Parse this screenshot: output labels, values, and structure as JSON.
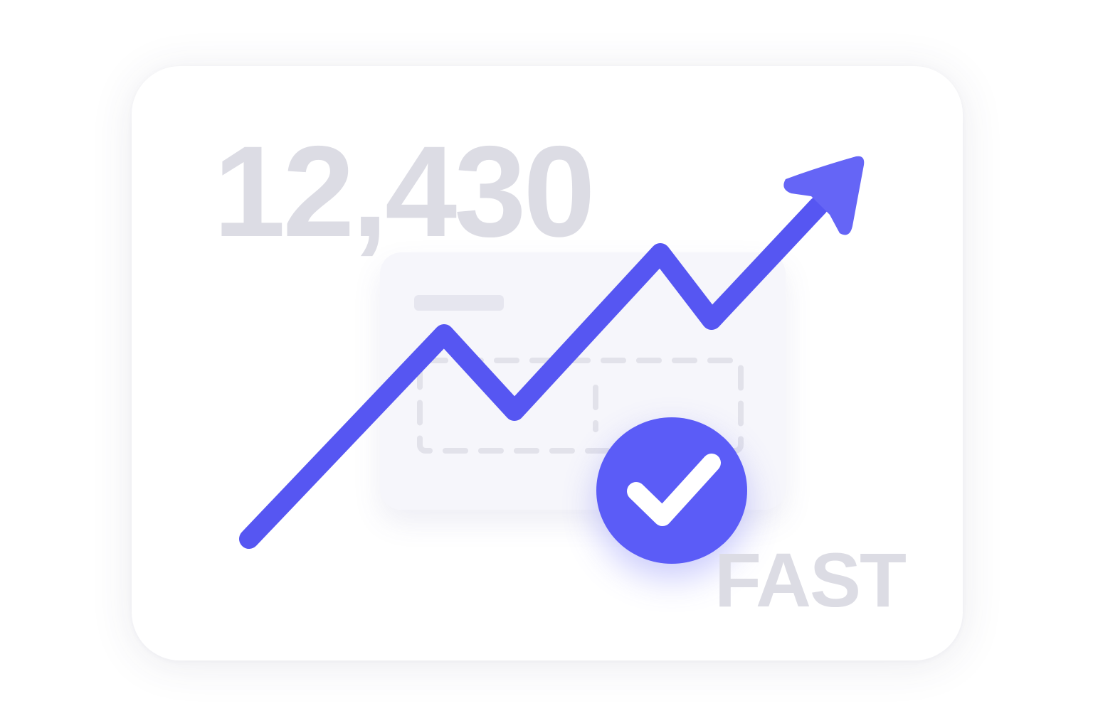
{
  "metric": {
    "value": "12,430"
  },
  "tagline": {
    "text": "FAST"
  },
  "icons": {
    "trend": "trend-up-arrow-icon",
    "badge": "checkmark-icon"
  },
  "colors": {
    "accent": "#5b5cf7",
    "muted_text": "#dcdce4",
    "panel": "#f6f6fb",
    "placeholder": "#e6e6ef"
  }
}
